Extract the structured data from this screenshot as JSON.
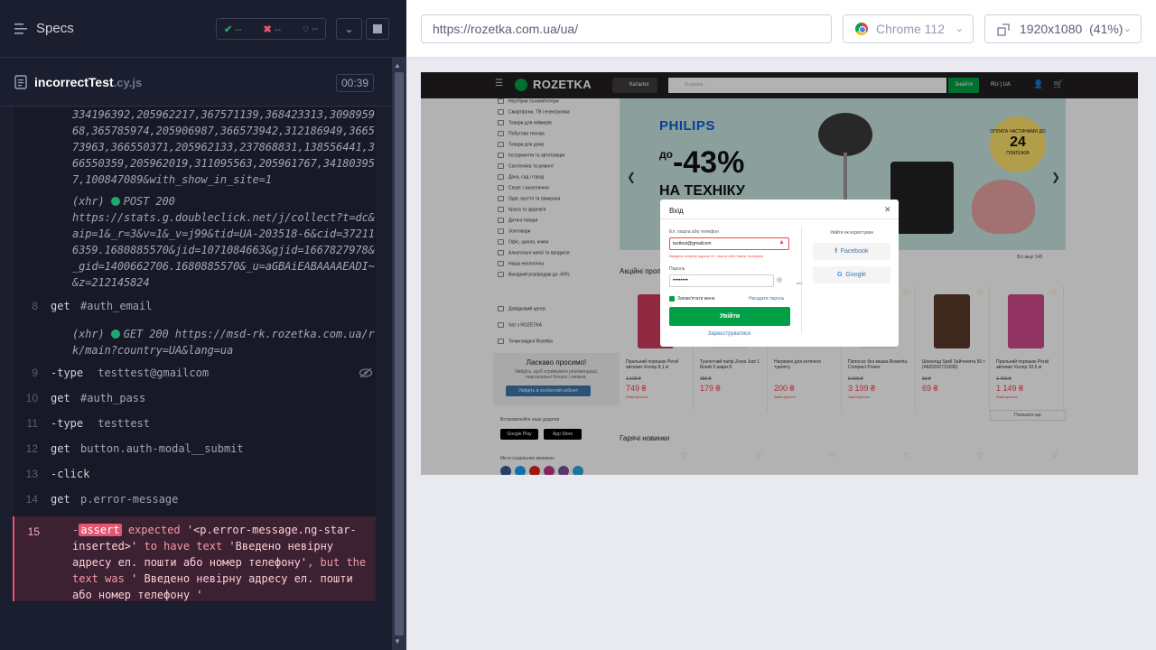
{
  "runner": {
    "specs_label": "Specs",
    "passed": "--",
    "failed": "--",
    "pending": "--",
    "spec_name": "incorrectTest",
    "spec_ext": ".cy.js",
    "duration": "00:39"
  },
  "commands": {
    "log1": "334196392,205962217,367571139,368423313,309895968,365785974,205906987,366573942,312186949,366573963,366550371,205962133,237868831,138556441,366550359,205962019,311095563,205961767,341803957,100847089&with_show_in_site=1",
    "log2_method": "(xhr)",
    "log2_status": "POST 200",
    "log2_url": "https://stats.g.doubleclick.net/j/collect?t=dc&aip=1&_r=3&v=1&_v=j99&tid=UA-203518-6&cid=372116359.1680885570&jid=1071084663&gjid=1667827978&_gid=1400662706.1680885570&_u=aGBAiEABAAAAEADI~&z=212145824",
    "l8_num": "8",
    "l8_cmd": "get",
    "l8_arg": "#auth_email",
    "log3_method": "(xhr)",
    "log3_status": "GET 200 https://msd-rk.rozetka.com.ua/rk/main?country=UA&lang=ua",
    "l9_num": "9",
    "l9_cmd": "type",
    "l9_arg": "testtest@gmailcom",
    "l10_num": "10",
    "l10_cmd": "get",
    "l10_arg": "#auth_pass",
    "l11_num": "11",
    "l11_cmd": "type",
    "l11_arg": "testtest",
    "l12_num": "12",
    "l12_cmd": "get",
    "l12_arg": "button.auth-modal__submit",
    "l13_num": "13",
    "l13_cmd": "click",
    "l14_num": "14",
    "l14_cmd": "get",
    "l14_arg": "p.error-message",
    "l15_num": "15",
    "l15_badge": "assert",
    "l15_expected": "expected",
    "l15_subject": "'<p.error-message.ng-star-inserted>'",
    "l15_mid": "to have text",
    "l15_value": "'Введено невірну адресу ел. пошти або номер телефону'",
    "l15_but": ", but the text was",
    "l15_actual": "' Введено невірну адресу ел. пошти або номер телефону '"
  },
  "browser": {
    "url": "https://rozetka.com.ua/ua/",
    "name": "Chrome 112",
    "viewport": "1920x1080",
    "scale": "(41%)"
  },
  "aut": {
    "logo": "ROZETKA",
    "catalog": "Каталог",
    "search_placeholder": "Я шукаю...",
    "search_btn": "Знайти",
    "lang": "RU | UA",
    "sidebar": [
      "Ноутбуки та комп'ютери",
      "Смартфони, ТВ і електроніка",
      "Товари для геймерів",
      "Побутова техніка",
      "Товари для дому",
      "Інструменти та автотовари",
      "Сантехніка та ремонт",
      "Дача, сад і город",
      "Спорт і захоплення",
      "Одяг, взуття та прикраси",
      "Краса та здоров'я",
      "Дитячі товари",
      "Зоотовари",
      "Офіс, школа, книги",
      "Алкогольні напої та продукти",
      "Наша екологічна",
      "Вихідний розпродаж до -60%"
    ],
    "side_extra": [
      "Довідковий центр",
      "Чат з ROZETKA",
      "Точки видачі Rozetka"
    ],
    "promo_title": "Ласкаво просимо!",
    "promo_sub": "Увійдіть, щоб отримувати рекомендації, персональні бонуси і знижки.",
    "promo_btn": "Увійдіть в особистий кабінет",
    "apps_label": "Встановлюйте наші додатки",
    "gplay": "Google Play",
    "astore": "App Store",
    "social_label": "Ми в соціальних мережах",
    "banner_brand": "PHILIPS",
    "banner_sale_pre": "до",
    "banner_sale": "-43%",
    "banner_tech": "НА ТЕХНІКУ",
    "badge_pre": "ОПЛАТА ЧАСТИНАМИ ДО",
    "badge_num": "24",
    "badge_post": "ПЛАТЕЖІВ",
    "row_title": "Акційні пропозиції",
    "all_link": "Всі акції 145",
    "products": [
      {
        "name": "Пральний порошок Persil автомат Колор 8,1 кг",
        "old": "1 108 ₴",
        "price": "749 ₴",
        "ends": "Закінчується"
      },
      {
        "name": "Туалетний папір Zewa Just 1 Білий 3 шари 8",
        "old": "289 ₴",
        "price": "179 ₴",
        "ends": ""
      },
      {
        "name": "Нагрівачі для котячого туалету",
        "old": "",
        "price": "200 ₴",
        "ends": "Закінчується"
      },
      {
        "name": "Пилосос без мішка Rowenta Compact Power",
        "old": "5 999 ₴",
        "price": "3 199 ₴",
        "ends": "Закінчується"
      },
      {
        "name": "Шоколад Spell Зайченята 50 г (4820202731595)",
        "old": "83 ₴",
        "price": "69 ₴",
        "ends": ""
      },
      {
        "name": "Пральний порошок Persil автомат Колор 10,5 кг",
        "old": "1 460 ₴",
        "price": "1 149 ₴",
        "ends": "Закінчується"
      }
    ],
    "more_btn": "Показати ще",
    "row2_title": "Гарячі новинки"
  },
  "modal": {
    "title": "Вхід",
    "email_label": "Ел. пошта або телефон",
    "email_value": "testtest@gmailcom",
    "error": "Введено невірну адресу ел. пошти або номер телефону",
    "pass_label": "Пароль",
    "pass_value": "••••••••",
    "or": "або",
    "remember": "Запам'ятати мене",
    "forgot": "Нагадати пароль",
    "login": "Увійти",
    "register": "Зареєструватися",
    "social_title": "Увійти як користувач",
    "fb": "Facebook",
    "google": "Google"
  }
}
